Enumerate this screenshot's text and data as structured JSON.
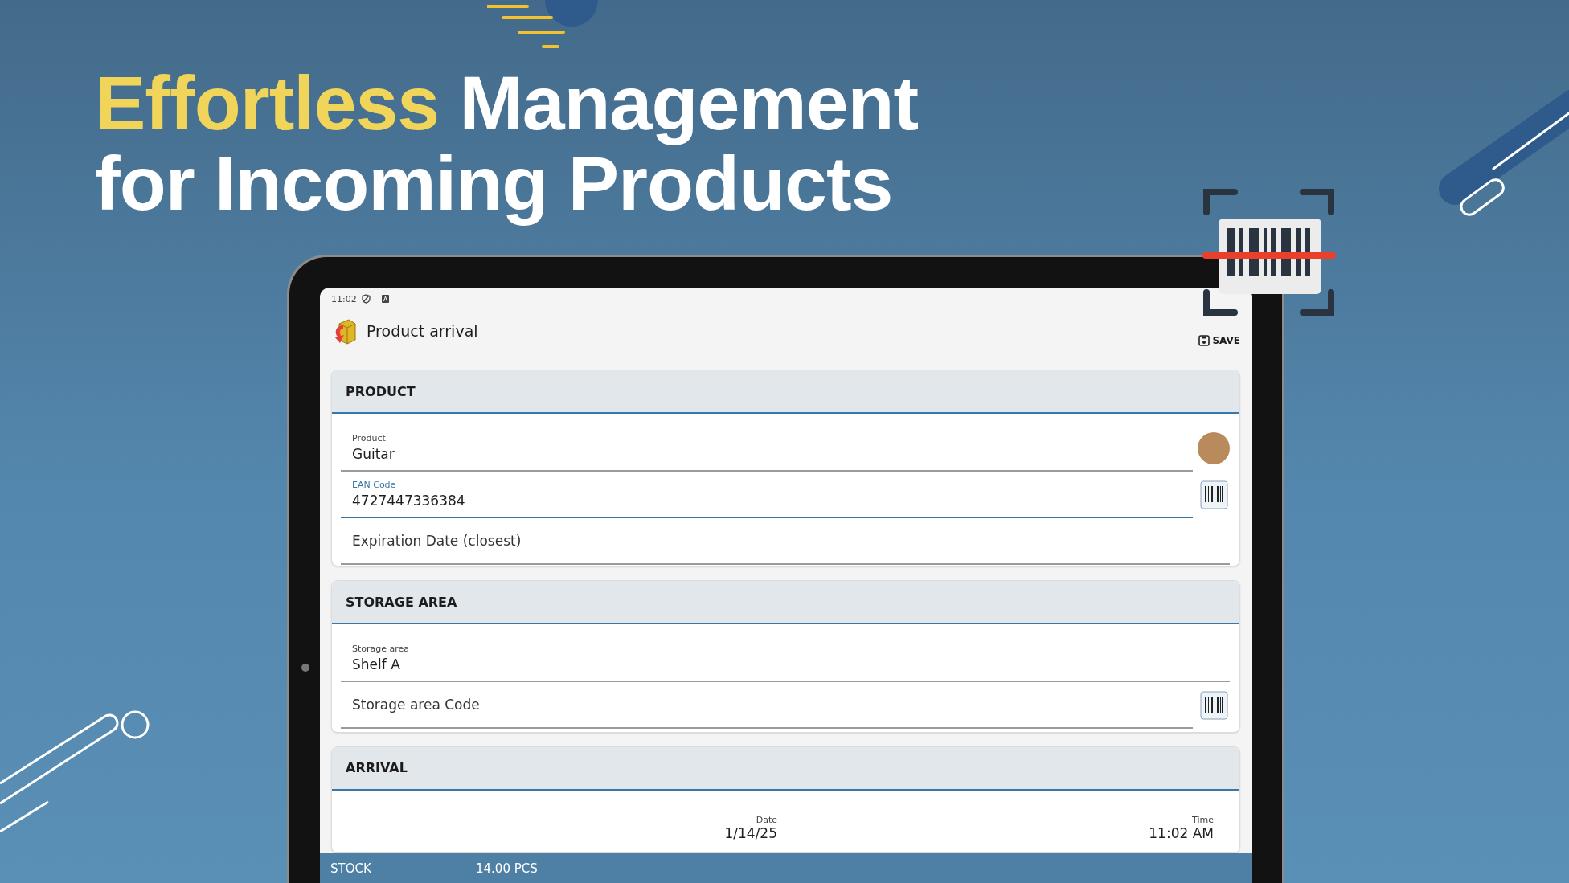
{
  "headline": {
    "lines": [
      {
        "segments": [
          {
            "text": "Effortless",
            "highlight": true
          },
          {
            "text": "Management",
            "highlight": false
          }
        ]
      },
      {
        "segments": [
          {
            "text": "for Incoming Products",
            "highlight": false
          }
        ]
      }
    ]
  },
  "status_bar": {
    "time": "11:02"
  },
  "app_bar": {
    "title": "Product arrival",
    "action": "SAVE"
  },
  "sections": [
    {
      "title": "PRODUCT",
      "kind": "fields",
      "fields": [
        {
          "label": "Product",
          "value": "Guitar",
          "focused": false,
          "has_photo": true
        },
        {
          "label": "EAN Code",
          "value": "4727447336384",
          "focused": true,
          "has_barcode_button": true
        },
        {
          "placeholder": "Expiration Date (closest)",
          "focused": false
        }
      ]
    },
    {
      "title": "STORAGE AREA",
      "kind": "fields",
      "fields": [
        {
          "label": "Storage area",
          "value": "Shelf A",
          "focused": false
        },
        {
          "placeholder": "Storage area Code",
          "focused": false,
          "has_barcode_button": true
        }
      ]
    },
    {
      "title": "ARRIVAL",
      "kind": "datetime",
      "items": [
        {
          "label": "Date",
          "value": "1/14/25"
        },
        {
          "label": "Time",
          "value": "11:02 AM"
        }
      ]
    }
  ],
  "bottom_bar": {
    "label": "STOCK",
    "value": "14.00 PCS"
  }
}
